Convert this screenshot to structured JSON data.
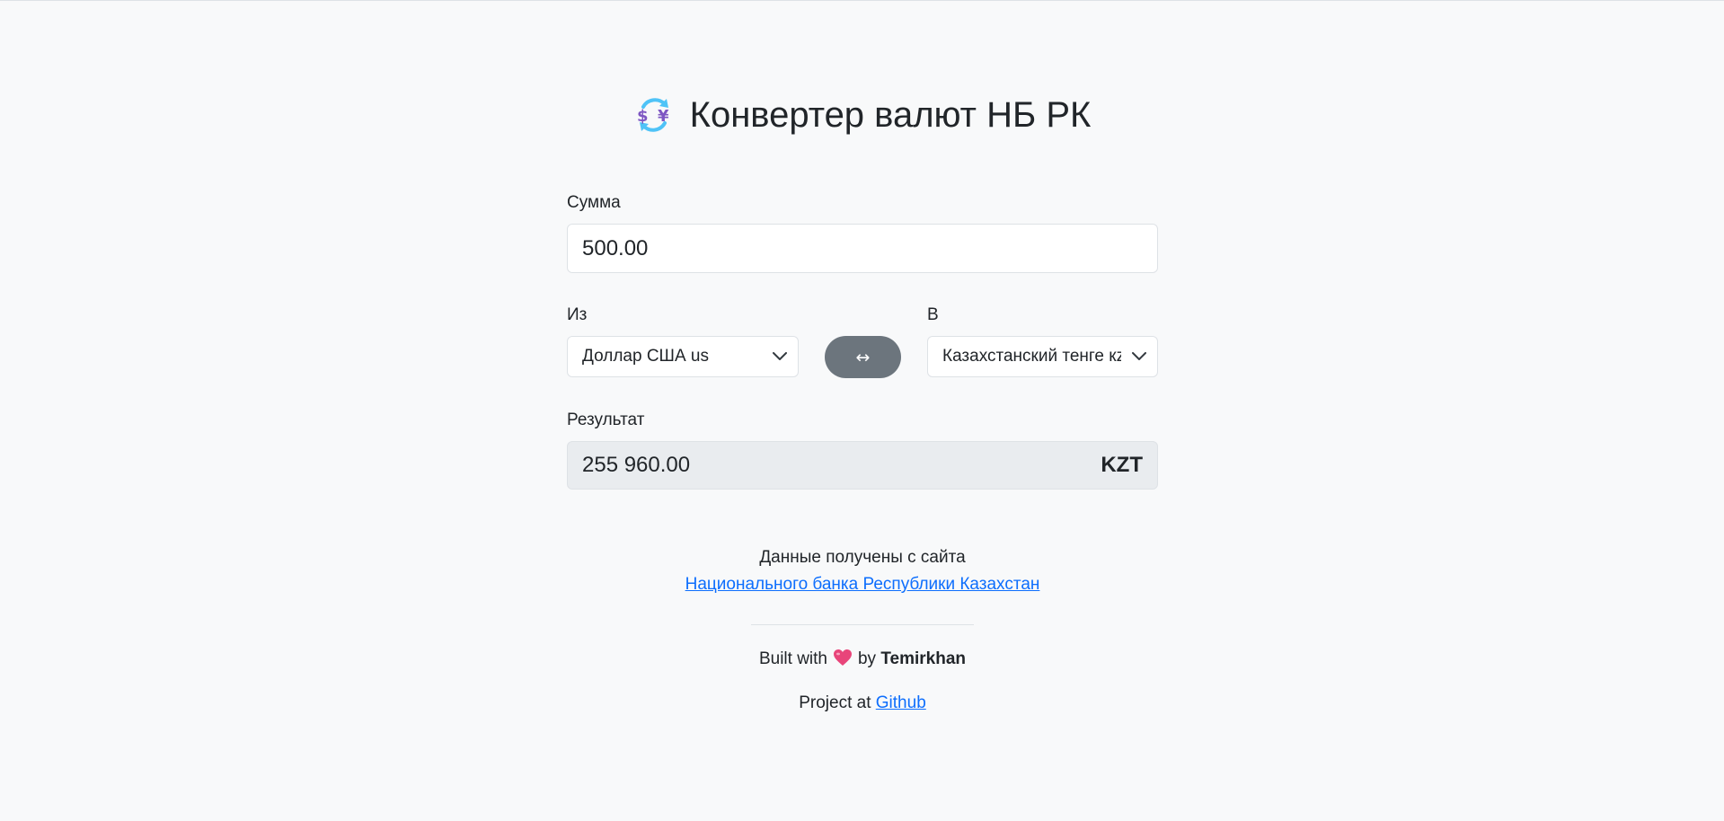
{
  "header": {
    "icon": "currency-exchange-icon",
    "title": "Конвертер валют НБ РК"
  },
  "form": {
    "amount_label": "Сумма",
    "amount_value": "500.00",
    "from_label": "Из",
    "from_selected": "Доллар США us",
    "swap_label": "↔",
    "to_label": "В",
    "to_selected": "Казахстанский тенге кz",
    "result_label": "Результат",
    "result_value": "255 960.00",
    "result_currency": "KZT"
  },
  "footer": {
    "source_text": "Данные получены с сайта",
    "source_link": "Национального банка Республики Казахстан",
    "built_with": "Built with",
    "by": "by",
    "author": "Temirkhan",
    "project_at": "Project at",
    "github_link": "Github"
  },
  "colors": {
    "background": "#f8f9fa",
    "swap_button": "#6c757d",
    "link": "#0d6efd",
    "result_bg": "#e9ecef"
  }
}
